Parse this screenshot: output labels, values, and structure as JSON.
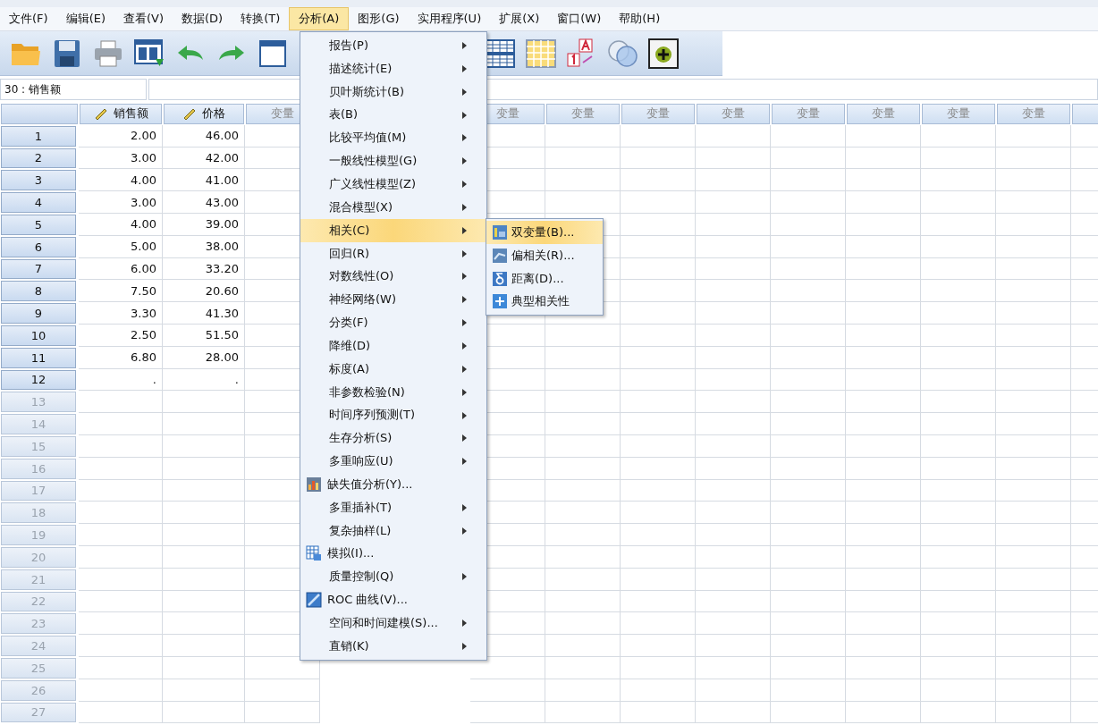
{
  "menu_bar": [
    {
      "label": "文件(F)",
      "selected": false
    },
    {
      "label": "编辑(E)",
      "selected": false
    },
    {
      "label": "查看(V)",
      "selected": false
    },
    {
      "label": "数据(D)",
      "selected": false
    },
    {
      "label": "转换(T)",
      "selected": false
    },
    {
      "label": "分析(A)",
      "selected": true
    },
    {
      "label": "图形(G)",
      "selected": false
    },
    {
      "label": "实用程序(U)",
      "selected": false
    },
    {
      "label": "扩展(X)",
      "selected": false
    },
    {
      "label": "窗口(W)",
      "selected": false
    },
    {
      "label": "帮助(H)",
      "selected": false
    }
  ],
  "cell_reference": "30 : 销售额",
  "table": {
    "columns": [
      {
        "label": "销售额",
        "kind": "scale"
      },
      {
        "label": "价格",
        "kind": "scale"
      },
      {
        "label": "变量",
        "kind": "empty"
      },
      {
        "kind": "hidden"
      },
      {
        "kind": "hidden"
      },
      {
        "label": "变量",
        "kind": "empty"
      },
      {
        "label": "变量",
        "kind": "empty"
      },
      {
        "label": "变量",
        "kind": "empty"
      },
      {
        "label": "变量",
        "kind": "empty"
      },
      {
        "label": "变量",
        "kind": "empty"
      },
      {
        "label": "变量",
        "kind": "empty"
      },
      {
        "label": "变量",
        "kind": "empty"
      },
      {
        "label": "变量",
        "kind": "empty"
      },
      {
        "kind": "cut"
      }
    ],
    "rows": [
      {
        "number": "1",
        "empty": false,
        "cells": [
          "2.00",
          "46.00"
        ]
      },
      {
        "number": "2",
        "empty": false,
        "cells": [
          "3.00",
          "42.00"
        ]
      },
      {
        "number": "3",
        "empty": false,
        "cells": [
          "4.00",
          "41.00"
        ]
      },
      {
        "number": "4",
        "empty": false,
        "cells": [
          "3.00",
          "43.00"
        ]
      },
      {
        "number": "5",
        "empty": false,
        "cells": [
          "4.00",
          "39.00"
        ]
      },
      {
        "number": "6",
        "empty": false,
        "cells": [
          "5.00",
          "38.00"
        ]
      },
      {
        "number": "7",
        "empty": false,
        "cells": [
          "6.00",
          "33.20"
        ]
      },
      {
        "number": "8",
        "empty": false,
        "cells": [
          "7.50",
          "20.60"
        ]
      },
      {
        "number": "9",
        "empty": false,
        "cells": [
          "3.30",
          "41.30"
        ]
      },
      {
        "number": "10",
        "empty": false,
        "cells": [
          "2.50",
          "51.50"
        ]
      },
      {
        "number": "11",
        "empty": false,
        "cells": [
          "6.80",
          "28.00"
        ]
      },
      {
        "number": "12",
        "empty": false,
        "cells": [
          ".",
          "."
        ]
      },
      {
        "number": "13",
        "empty": true
      },
      {
        "number": "14",
        "empty": true
      },
      {
        "number": "15",
        "empty": true
      },
      {
        "number": "16",
        "empty": true
      },
      {
        "number": "17",
        "empty": true
      },
      {
        "number": "18",
        "empty": true
      },
      {
        "number": "19",
        "empty": true
      },
      {
        "number": "20",
        "empty": true
      },
      {
        "number": "21",
        "empty": true
      },
      {
        "number": "22",
        "empty": true
      },
      {
        "number": "23",
        "empty": true
      },
      {
        "number": "24",
        "empty": true
      },
      {
        "number": "25",
        "empty": true
      },
      {
        "number": "26",
        "empty": true
      },
      {
        "number": "27",
        "empty": true
      }
    ]
  },
  "analyze_menu": [
    {
      "label": "报告(P)",
      "kind": "submenu",
      "selected": false
    },
    {
      "label": "描述统计(E)",
      "kind": "submenu",
      "selected": false
    },
    {
      "label": "贝叶斯统计(B)",
      "kind": "submenu",
      "selected": false
    },
    {
      "label": "表(B)",
      "kind": "submenu",
      "selected": false
    },
    {
      "label": "比较平均值(M)",
      "kind": "submenu",
      "selected": false
    },
    {
      "label": "一般线性模型(G)",
      "kind": "submenu",
      "selected": false
    },
    {
      "label": "广义线性模型(Z)",
      "kind": "submenu",
      "selected": false
    },
    {
      "label": "混合模型(X)",
      "kind": "submenu",
      "selected": false
    },
    {
      "label": "相关(C)",
      "kind": "submenu",
      "selected": true
    },
    {
      "label": "回归(R)",
      "kind": "submenu",
      "selected": false
    },
    {
      "label": "对数线性(O)",
      "kind": "submenu",
      "selected": false
    },
    {
      "label": "神经网络(W)",
      "kind": "submenu",
      "selected": false
    },
    {
      "label": "分类(F)",
      "kind": "submenu",
      "selected": false
    },
    {
      "label": "降维(D)",
      "kind": "submenu",
      "selected": false
    },
    {
      "label": "标度(A)",
      "kind": "submenu",
      "selected": false
    },
    {
      "label": "非参数检验(N)",
      "kind": "submenu",
      "selected": false
    },
    {
      "label": "时间序列预测(T)",
      "kind": "submenu",
      "selected": false
    },
    {
      "label": "生存分析(S)",
      "kind": "submenu",
      "selected": false
    },
    {
      "label": "多重响应(U)",
      "kind": "submenu",
      "selected": false
    },
    {
      "label": "缺失值分析(Y)...",
      "kind": "dialog",
      "selected": false
    },
    {
      "label": "多重插补(T)",
      "kind": "submenu",
      "selected": false
    },
    {
      "label": "复杂抽样(L)",
      "kind": "submenu",
      "selected": false
    },
    {
      "label": "模拟(I)...",
      "kind": "dialog",
      "selected": false
    },
    {
      "label": "质量控制(Q)",
      "kind": "submenu",
      "selected": false
    },
    {
      "label": "ROC 曲线(V)...",
      "kind": "dialog",
      "selected": false
    },
    {
      "label": "空间和时间建模(S)...",
      "kind": "submenu",
      "selected": false
    },
    {
      "label": "直销(K)",
      "kind": "submenu",
      "selected": false
    }
  ],
  "correlate_submenu": [
    {
      "label": "双变量(B)...",
      "selected": true
    },
    {
      "label": "偏相关(R)...",
      "selected": false
    },
    {
      "label": "距离(D)...",
      "selected": false
    },
    {
      "label": "典型相关性",
      "selected": false
    }
  ]
}
